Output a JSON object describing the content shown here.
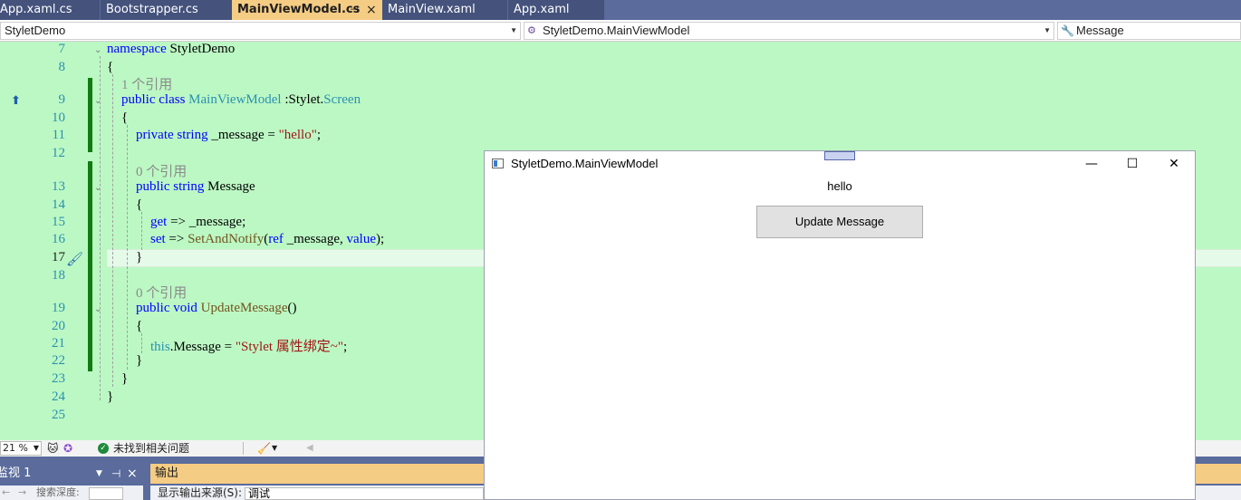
{
  "tabs": [
    {
      "label": "App.xaml.cs"
    },
    {
      "label": "Bootstrapper.cs"
    },
    {
      "label": "MainViewModel.cs",
      "pin": "⊣",
      "close": "×"
    },
    {
      "label": "MainView.xaml"
    },
    {
      "label": "App.xaml"
    }
  ],
  "nav": {
    "project": "StyletDemo",
    "type": "StyletDemo.MainViewModel",
    "member": "Message"
  },
  "line_numbers": [
    "7",
    "8",
    "9",
    "10",
    "11",
    "12",
    "13",
    "14",
    "15",
    "16",
    "17",
    "18",
    "19",
    "20",
    "21",
    "22",
    "23",
    "24",
    "25"
  ],
  "code": {
    "l7_kw": "namespace",
    "l7_name": " StyletDemo",
    "l8": "{",
    "lens1": "1 个引用",
    "l9_public": "public",
    "l9_class": " class ",
    "l9_name": "MainViewModel",
    "l9_colon": " :",
    "l9_stylet": "Stylet.",
    "l9_screen": "Screen",
    "l10": "{",
    "l11_private": "private",
    "l11_string": " string",
    "l11_field": " _message = ",
    "l11_str": "\"hello\"",
    "l11_semi": ";",
    "lens2": "0 个引用",
    "l13_public": "public",
    "l13_string": " string",
    "l13_name": " Message",
    "l14": "{",
    "l15_get": "get",
    "l15_rest": " => _message;",
    "l16_set": "set",
    "l16_arrow": " => ",
    "l16_method": "SetAndNotify",
    "l16_paren": "(",
    "l16_ref": "ref",
    "l16_mid": " _message, ",
    "l16_value": "value",
    "l16_end": ");",
    "l17": "}",
    "lens3": "0 个引用",
    "l19_public": "public",
    "l19_void": " void",
    "l19_sp": " ",
    "l19_method": "UpdateMessage",
    "l19_paren": "()",
    "l20": "{",
    "l21_this": "this",
    "l21_mid": ".Message = ",
    "l21_str": "\"Stylet 属性绑定~\"",
    "l21_semi": ";",
    "l22": "}",
    "l23": "}",
    "l24": "}"
  },
  "status": {
    "zoom": "21 %",
    "issues": "未找到相关问题"
  },
  "bottom": {
    "watch_title": "监视 1",
    "search_depth": "搜索深度:",
    "output_title": "输出",
    "output_source_label": "显示输出来源(S):",
    "output_source_value": "调试"
  },
  "app_window": {
    "title": "StyletDemo.MainViewModel",
    "message": "hello",
    "button": "Update Message",
    "minimize": "—",
    "maximize": "☐",
    "close": "✕"
  },
  "colors": {
    "editor_bg": "#bcf8c4",
    "keyword": "#0000ff",
    "type": "#2b91af",
    "string": "#a31515",
    "active_tab": "#f5cc84"
  }
}
